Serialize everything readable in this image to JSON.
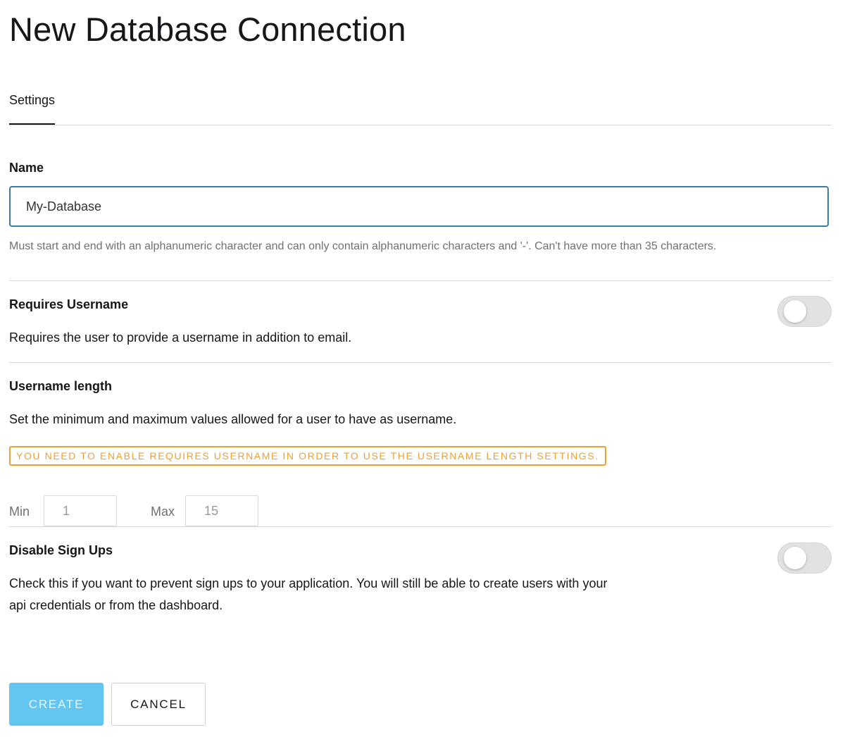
{
  "page": {
    "title": "New Database Connection"
  },
  "tabs": [
    {
      "label": "Settings",
      "active": true
    }
  ],
  "name_field": {
    "label": "Name",
    "value": "My-Database",
    "help": "Must start and end with an alphanumeric character and can only contain alphanumeric characters and '-'. Can't have more than 35 characters."
  },
  "requires_username": {
    "label": "Requires Username",
    "description": "Requires the user to provide a username in addition to email.",
    "enabled": false
  },
  "username_length": {
    "label": "Username length",
    "description": "Set the minimum and maximum values allowed for a user to have as username.",
    "warning": "YOU NEED TO ENABLE REQUIRES USERNAME IN ORDER TO USE THE USERNAME LENGTH SETTINGS.",
    "min_label": "Min",
    "min_value": "1",
    "max_label": "Max",
    "max_value": "15"
  },
  "disable_signups": {
    "label": "Disable Sign Ups",
    "description_line1": "Check this if you want to prevent sign ups to your application. You will still be able to create users with your",
    "description_line2": "api credentials or from the dashboard.",
    "enabled": false
  },
  "actions": {
    "create_label": "CREATE",
    "cancel_label": "CANCEL"
  },
  "colors": {
    "accent": "#63c6f1",
    "input_focus_border": "#3f7aa0",
    "warning": "#f0a030",
    "toggle_off": "#e2e2e2"
  }
}
